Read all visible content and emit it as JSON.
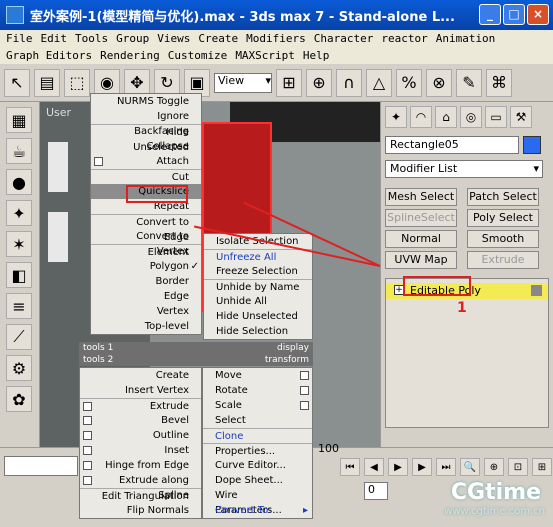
{
  "window": {
    "title": "室外案例-1(模型精简与优化).max - 3ds max 7  - Stand-alone L...",
    "buttons": [
      "_",
      "□",
      "×"
    ]
  },
  "menubar": {
    "row1": [
      "File",
      "Edit",
      "Tools",
      "Group",
      "Views",
      "Create",
      "Modifiers",
      "Character",
      "reactor",
      "Animation"
    ],
    "row2": [
      "Graph Editors",
      "Rendering",
      "Customize",
      "MAXScript",
      "Help"
    ]
  },
  "toolbar": {
    "view_select": "View"
  },
  "viewport": {
    "label": "User"
  },
  "command_panel": {
    "object_name": "Rectangle05",
    "modifier_list": "Modifier List",
    "buttons": [
      "Mesh Select",
      "Patch Select",
      "SplineSelect",
      "Poly Select",
      "Normal",
      "Smooth",
      "UVW Map",
      "Extrude"
    ],
    "disabled": [
      "SplineSelect",
      "Extrude"
    ],
    "stack_item": "Editable Poly",
    "annotation": "1"
  },
  "quad_menu": {
    "top_left": [
      "NURMS Toggle",
      "Ignore Backfacing",
      "Hide Unselected",
      "Collapse",
      "Attach",
      "Cut",
      "Quickslice",
      "Repeat",
      "Convert to Edge",
      "Convert to Vertex",
      "Element",
      "Polygon",
      "Border",
      "Edge",
      "Vertex",
      "Top-level"
    ],
    "top_right": [
      "Isolate Selection",
      "Unfreeze All",
      "Freeze Selection",
      "Unhide by Name",
      "Unhide All",
      "Hide Unselected",
      "Hide Selection"
    ],
    "header_tools1": "tools 1",
    "header_display": "display",
    "header_tools2": "tools 2",
    "header_transform": "transform",
    "bottom_left": [
      "Create",
      "Insert Vertex",
      "Extrude",
      "Bevel",
      "Outline",
      "Inset",
      "Hinge from Edge",
      "Extrude along Spline",
      "Edit Triangulation",
      "Flip Normals"
    ],
    "bottom_right": [
      "Move",
      "Rotate",
      "Scale",
      "Select",
      "Clone",
      "Properties...",
      "Curve Editor...",
      "Dope Sheet...",
      "Wire Parameters...",
      "Convert To:"
    ]
  },
  "status": {
    "frame": "100",
    "field_value": "0"
  },
  "watermark": {
    "brand": "CGtime",
    "url": "www.cgtime.com.cn"
  }
}
